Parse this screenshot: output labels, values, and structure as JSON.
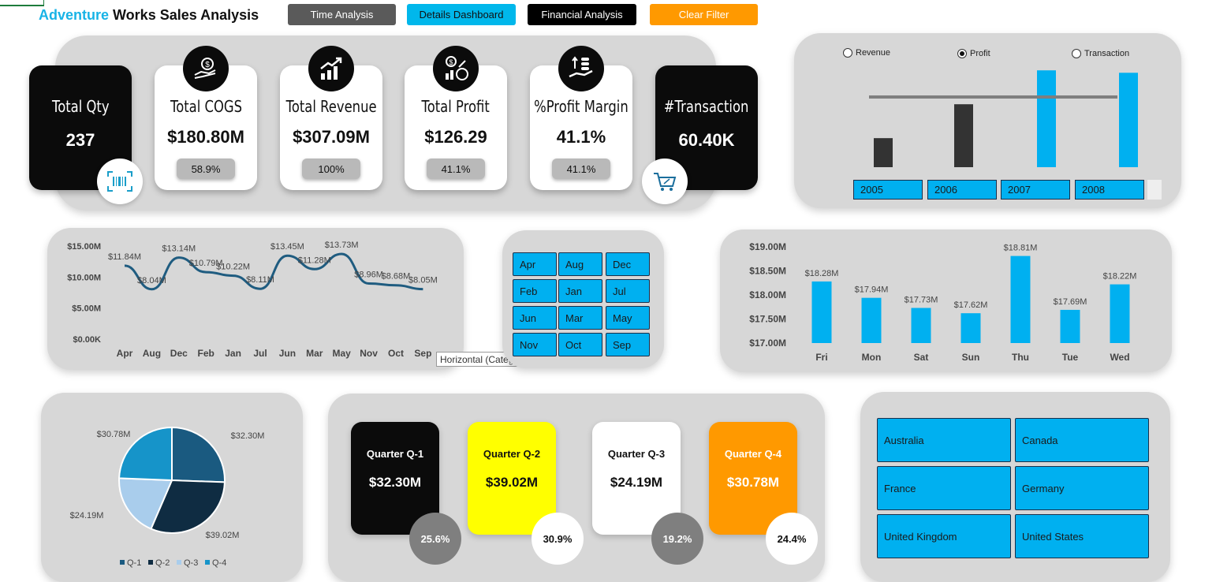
{
  "header": {
    "brand": "Adventure",
    "title_rest": " Works Sales Analysis"
  },
  "nav": [
    {
      "label": "Time Analysis",
      "bg": "#5a5a5a",
      "fg": "#ffffff"
    },
    {
      "label": "Details Dashboard",
      "bg": "#00b7eb",
      "fg": "#111111"
    },
    {
      "label": "Financial Analysis",
      "bg": "#000000",
      "fg": "#ffffff"
    },
    {
      "label": "Clear Filter",
      "bg": "#ff9900",
      "fg": "#ffffff"
    }
  ],
  "kpis": [
    {
      "label": "Total Qty",
      "value": "237",
      "theme": "dark"
    },
    {
      "label": "Total COGS",
      "value": "$180.80M",
      "sub": "58.9%",
      "theme": "light",
      "icon": "money-bag-hand-icon"
    },
    {
      "label": "Total Revenue",
      "value": "$307.09M",
      "sub": "100%",
      "theme": "light",
      "icon": "growth-chart-icon"
    },
    {
      "label": "Total Profit",
      "value": "$126.29",
      "sub": "41.1%",
      "theme": "light",
      "icon": "profit-coins-icon"
    },
    {
      "label": "%Profit Margin",
      "value": "41.1%",
      "sub": "41.1%",
      "theme": "light",
      "icon": "hand-coins-icon"
    },
    {
      "label": "#Transaction",
      "value": "60.40K",
      "theme": "dark"
    }
  ],
  "year_panel": {
    "metrics": [
      {
        "label": "Revenue",
        "selected": false
      },
      {
        "label": "Profit",
        "selected": true
      },
      {
        "label": "Transaction",
        "selected": false
      }
    ],
    "years": [
      "2005",
      "2006",
      "2007",
      "2008"
    ]
  },
  "months_slicer": [
    "Apr",
    "Aug",
    "Dec",
    "Feb",
    "Jan",
    "Jul",
    "Jun",
    "Mar",
    "May",
    "Nov",
    "Oct",
    "Sep"
  ],
  "tooltip": "Horizontal (Category) Axis",
  "quarters": [
    {
      "label": "Quarter Q-1",
      "value": "$32.30M",
      "pct": "25.6%",
      "bg": "#0b0b0b",
      "fg": "#ffffff",
      "circ_bg": "#7f7f7f",
      "circ_fg": "#ffffff"
    },
    {
      "label": "Quarter Q-2",
      "value": "$39.02M",
      "pct": "30.9%",
      "bg": "#ffff00",
      "fg": "#111111",
      "circ_bg": "#ffffff",
      "circ_fg": "#111111"
    },
    {
      "label": "Quarter Q-3",
      "value": "$24.19M",
      "pct": "19.2%",
      "bg": "#ffffff",
      "fg": "#111111",
      "circ_bg": "#7f7f7f",
      "circ_fg": "#ffffff"
    },
    {
      "label": "Quarter Q-4",
      "value": "$30.78M",
      "pct": "24.4%",
      "bg": "#ff9900",
      "fg": "#ffffff",
      "circ_bg": "#ffffff",
      "circ_fg": "#111111"
    }
  ],
  "countries": [
    "Australia",
    "Canada",
    "France",
    "Germany",
    "United Kingdom",
    "United States"
  ],
  "chart_data": [
    {
      "type": "bar",
      "categories": [
        "2005",
        "2006",
        "2007",
        "2008"
      ],
      "values": [
        1.2,
        2.6,
        4.0,
        3.9
      ],
      "colors": [
        "#333333",
        "#333333",
        "#00b0f0",
        "#00b0f0"
      ],
      "reference_line": 2.9,
      "ylim": [
        0,
        4.3
      ]
    },
    {
      "type": "line",
      "categories": [
        "Apr",
        "Aug",
        "Dec",
        "Feb",
        "Jan",
        "Jul",
        "Jun",
        "Mar",
        "May",
        "Nov",
        "Oct",
        "Sep"
      ],
      "values": [
        11.84,
        8.04,
        13.14,
        10.79,
        10.22,
        8.11,
        13.45,
        11.28,
        13.73,
        8.96,
        8.68,
        8.05
      ],
      "data_labels": [
        "$11.84M",
        "$8.04M",
        "$13.14M",
        "$10.79M",
        "$10.22M",
        "$8.11M",
        "$13.45M",
        "$11.28M",
        "$13.73M",
        "$8.96M",
        "$8.68M",
        "$8.05M"
      ],
      "yticks": [
        "$0.00K",
        "$5.00M",
        "$10.00M",
        "$15.00M"
      ],
      "ylim": [
        0,
        15
      ],
      "color": "#1f5c80"
    },
    {
      "type": "bar",
      "categories": [
        "Fri",
        "Mon",
        "Sat",
        "Sun",
        "Thu",
        "Tue",
        "Wed"
      ],
      "values": [
        18.28,
        17.94,
        17.73,
        17.62,
        18.81,
        17.69,
        18.22
      ],
      "data_labels": [
        "$18.28M",
        "$17.94M",
        "$17.73M",
        "$17.62M",
        "$18.81M",
        "$17.69M",
        "$18.22M"
      ],
      "yticks": [
        "$17.00M",
        "$17.50M",
        "$18.00M",
        "$18.50M",
        "$19.00M"
      ],
      "ylim": [
        17,
        19
      ],
      "color": "#00b0f0"
    },
    {
      "type": "pie",
      "categories": [
        "Q-1",
        "Q-2",
        "Q-3",
        "Q-4"
      ],
      "values": [
        32.3,
        39.02,
        24.19,
        30.78
      ],
      "data_labels": [
        "$32.30M",
        "$39.02M",
        "$24.19M",
        "$30.78M"
      ],
      "colors": [
        "#1a5a80",
        "#0f2c42",
        "#a9cdec",
        "#1694c9"
      ],
      "legend": "bottom"
    }
  ]
}
